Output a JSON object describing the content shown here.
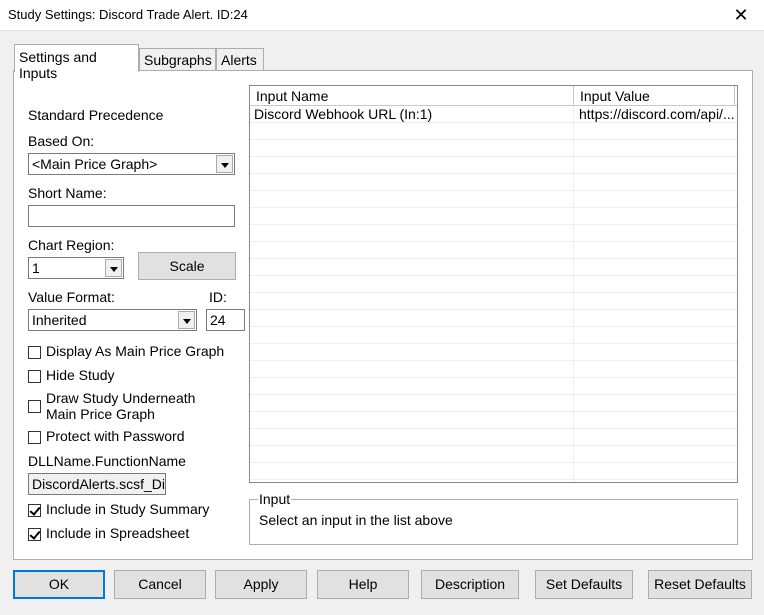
{
  "window": {
    "title": "Study Settings: Discord Trade Alert. ID:24",
    "close_icon": "close-icon"
  },
  "tabs": [
    {
      "label": "Settings and Inputs",
      "active": true
    },
    {
      "label": "Subgraphs",
      "active": false
    },
    {
      "label": "Alerts",
      "active": false
    }
  ],
  "settings": {
    "standard_precedence": "Standard Precedence",
    "based_on_label": "Based On:",
    "based_on_value": "<Main Price Graph>",
    "short_name_label": "Short Name:",
    "short_name_value": "",
    "chart_region_label": "Chart Region:",
    "chart_region_value": "1",
    "scale_button": "Scale",
    "value_format_label": "Value Format:",
    "value_format_value": "Inherited",
    "id_label": "ID:",
    "id_value": "24",
    "checkboxes": [
      {
        "label": "Display As Main Price Graph",
        "checked": false
      },
      {
        "label": "Hide Study",
        "checked": false
      },
      {
        "label": "Draw Study Underneath",
        "label2": "Main Price Graph",
        "checked": false
      },
      {
        "label": "Protect with Password",
        "checked": false
      }
    ],
    "dll_label": "DLLName.FunctionName",
    "dll_value": "DiscordAlerts.scsf_Dis",
    "include_summary": {
      "label": "Include in Study Summary",
      "checked": true
    },
    "include_spreadsheet": {
      "label": "Include in Spreadsheet",
      "checked": true
    }
  },
  "inputs_grid": {
    "columns": [
      "Input Name",
      "Input Value"
    ],
    "rows": [
      [
        "Discord Webhook URL  (In:1)",
        "https://discord.com/api/..."
      ]
    ]
  },
  "input_group": {
    "title": "Input",
    "text": "Select an input in the list above"
  },
  "buttons": {
    "ok": "OK",
    "cancel": "Cancel",
    "apply": "Apply",
    "help": "Help",
    "description": "Description",
    "set_defaults": "Set Defaults",
    "reset_defaults": "Reset Defaults"
  }
}
